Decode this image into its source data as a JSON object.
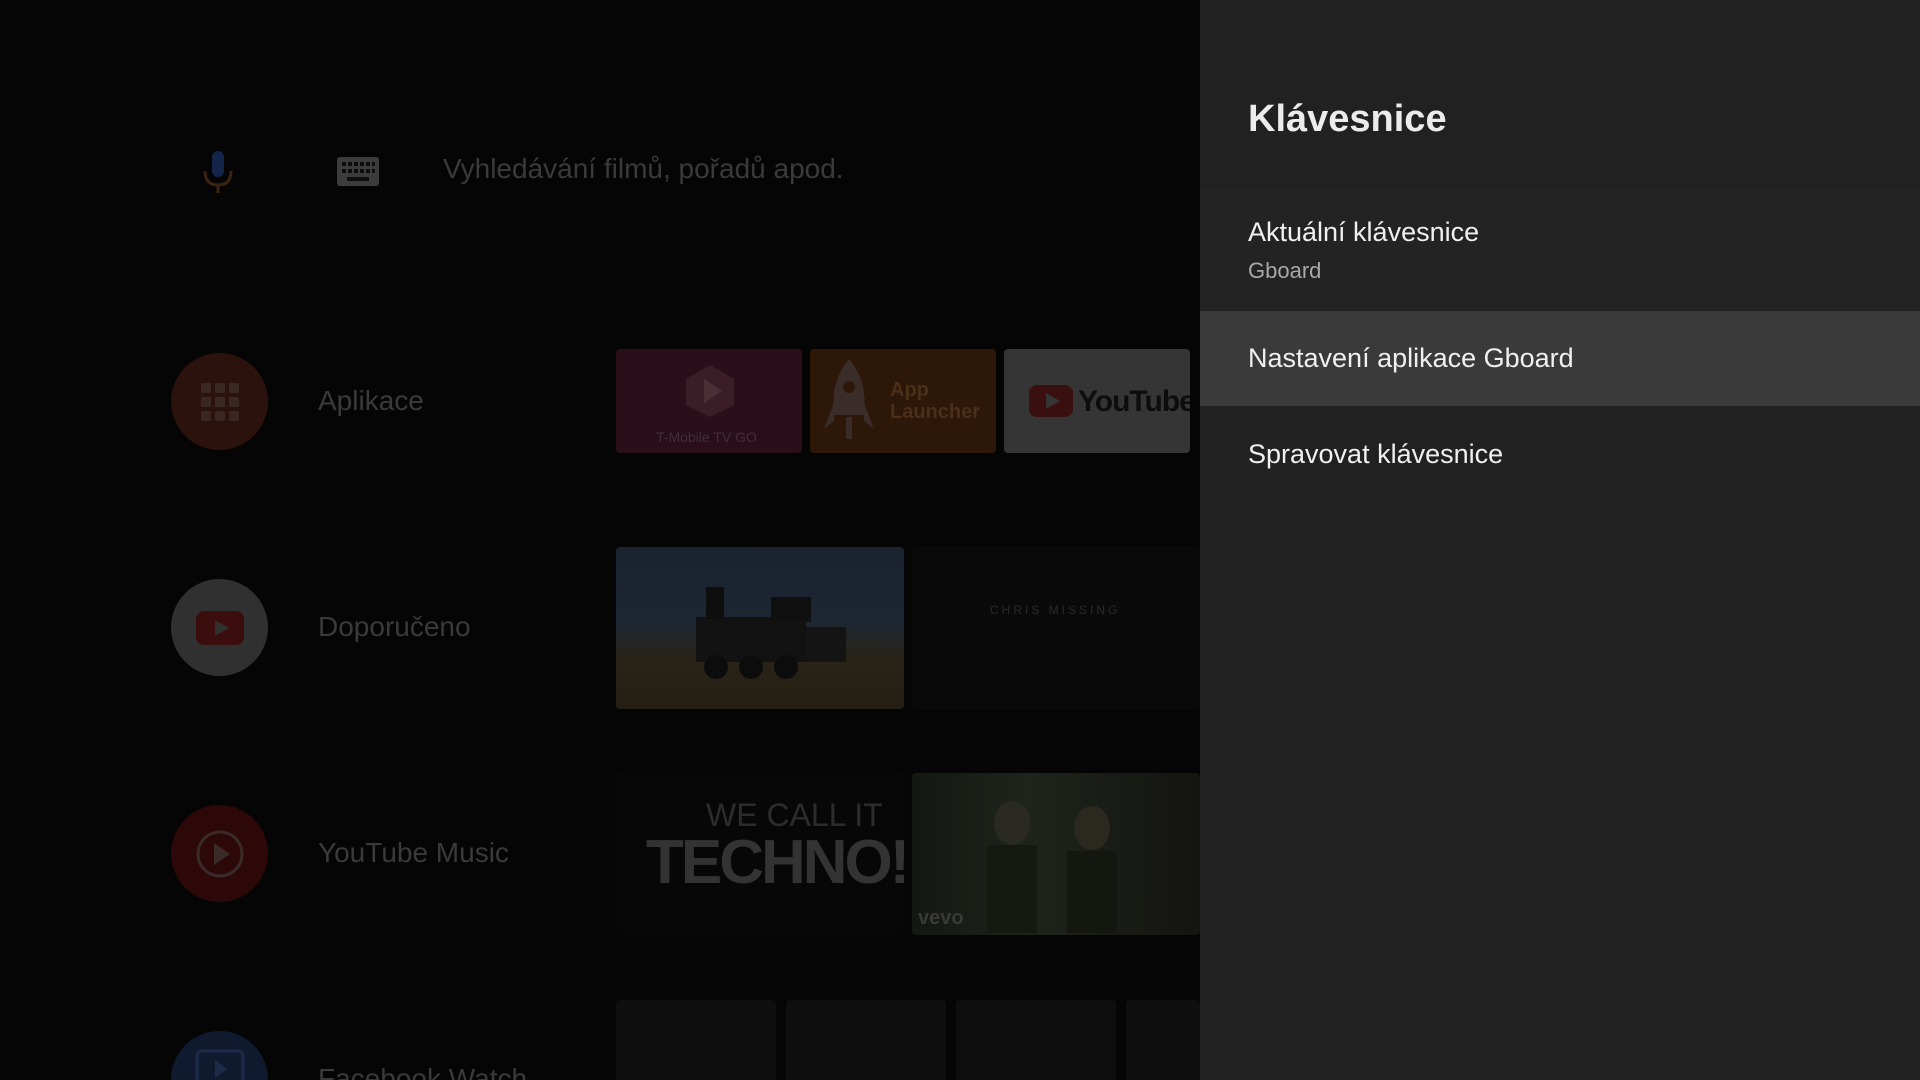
{
  "search": {
    "placeholder": "Vyhledávání filmů, pořadů apod."
  },
  "rows": [
    {
      "label": "Aplikace",
      "icon": "apps-grid-icon"
    },
    {
      "label": "Doporučeno",
      "icon": "youtube-icon"
    },
    {
      "label": "YouTube Music",
      "icon": "youtube-music-icon"
    },
    {
      "label": "Facebook Watch",
      "icon": "facebook-watch-icon"
    }
  ],
  "apps": [
    {
      "label": "T-Mobile TV GO"
    },
    {
      "label": "App Launcher"
    },
    {
      "label": "YouTube"
    }
  ],
  "recommended": [
    {
      "text": ""
    },
    {
      "text": "CHRIS MISSING"
    }
  ],
  "music": [
    {
      "line1": "WE CALL IT",
      "line2": "TECHNO!"
    },
    {
      "badge": "vevo"
    }
  ],
  "panel": {
    "title": "Klávesnice",
    "items": [
      {
        "title": "Aktuální klávesnice",
        "subtitle": "Gboard"
      },
      {
        "title": "Nastavení aplikace Gboard"
      },
      {
        "title": "Spravovat klávesnice"
      }
    ]
  },
  "colors": {
    "panel_bg": "#212121",
    "selected_bg": "#3a3a3a",
    "text_primary": "#f0f0f0",
    "text_secondary": "#a8a8a8"
  }
}
